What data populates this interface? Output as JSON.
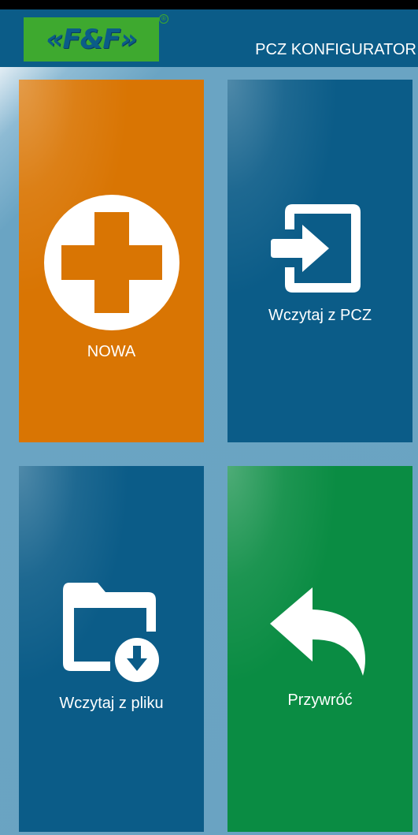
{
  "header": {
    "logo_text": "«F&F»",
    "registered_mark": "®",
    "title": "PCZ KONFIGURATOR"
  },
  "tiles": [
    {
      "label": "NOWA",
      "icon": "plus-circle-icon",
      "color": "#d97503"
    },
    {
      "label": "Wczytaj z PCZ",
      "icon": "import-door-icon",
      "color": "#0b5c88"
    },
    {
      "label": "Wczytaj z pliku",
      "icon": "folder-download-icon",
      "color": "#0b5c88"
    },
    {
      "label": "Przywróć",
      "icon": "undo-arrow-icon",
      "color": "#0a8c43"
    }
  ],
  "colors": {
    "header_bg": "#0b5c88",
    "logo_green": "#3ea92f",
    "background": "#6aa3c2"
  }
}
